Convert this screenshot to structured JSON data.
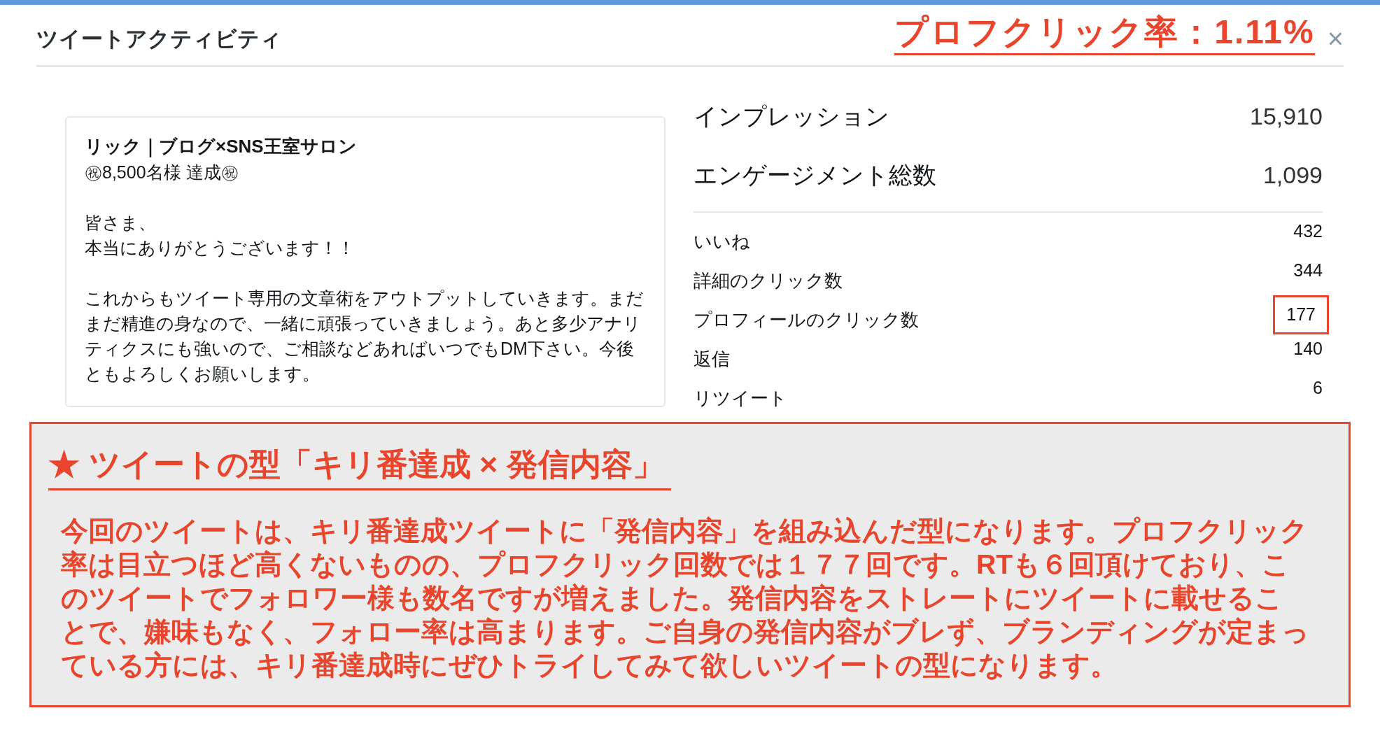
{
  "dialog": {
    "title": "ツイートアクティビティ",
    "close": "×"
  },
  "annotation_rate": "プロフクリック率：1.11%",
  "tweet": {
    "author": "リック｜ブログ×SNS王室サロン",
    "subtitle": "㊗8,500名様 達成㊗",
    "paragraphs": [
      [
        "皆さま、",
        "本当にありがとうございます！！"
      ],
      [
        "これからもツイート専用の文章術をアウトプットしていきます。まだまだ精進の身なので、一緒に頑張っていきましょう。あと多少アナリティクスにも強いので、ご相談などあればいつでもDM下さい。今後ともよろしくお願いします。"
      ]
    ]
  },
  "summary": [
    {
      "label": "インプレッション",
      "value": "15,910"
    },
    {
      "label": "エンゲージメント総数",
      "value": "1,099"
    }
  ],
  "details": [
    {
      "label": "いいね",
      "value": "432",
      "highlighted": false
    },
    {
      "label": "詳細のクリック数",
      "value": "344",
      "highlighted": false
    },
    {
      "label": "プロフィールのクリック数",
      "value": "177",
      "highlighted": true
    },
    {
      "label": "返信",
      "value": "140",
      "highlighted": false
    },
    {
      "label": "リツイート",
      "value": "6",
      "highlighted": false
    }
  ],
  "note": {
    "heading": "★ ツイートの型「キリ番達成 × 発信内容」",
    "body": "今回のツイートは、キリ番達成ツイートに「発信内容」を組み込んだ型になります。プロフクリック率は目立つほど高くないものの、プロフクリック回数では１７７回です。RTも６回頂けており、このツイートでフォロワー様も数名ですが増えました。発信内容をストレートにツイートに載せることで、嫌味もなく、フォロー率は高まります。ご自身の発信内容がブレず、ブランディングが定まっている方には、キリ番達成時にぜひトライしてみて欲しいツイートの型になります。"
  }
}
